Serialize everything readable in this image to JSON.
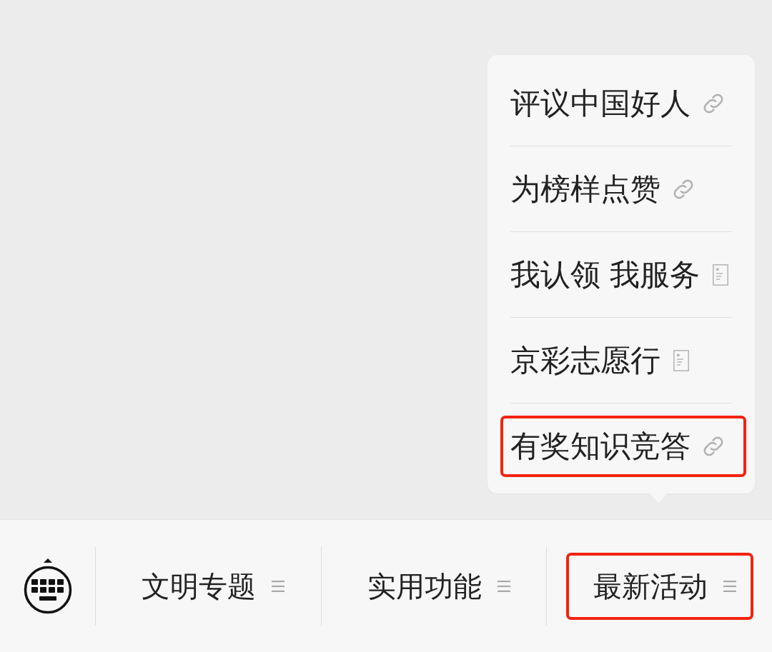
{
  "popup_menu": {
    "items": [
      {
        "label": "评议中国好人",
        "kind": "link",
        "highlighted": false
      },
      {
        "label": "为榜样点赞",
        "kind": "link",
        "highlighted": false
      },
      {
        "label": "我认领 我服务",
        "kind": "page",
        "highlighted": false
      },
      {
        "label": "京彩志愿行",
        "kind": "page",
        "highlighted": false
      },
      {
        "label": "有奖知识竞答",
        "kind": "link",
        "highlighted": true
      }
    ]
  },
  "bottom_bar": {
    "tabs": [
      {
        "label": "文明专题",
        "highlighted": false
      },
      {
        "label": "实用功能",
        "highlighted": false
      },
      {
        "label": "最新活动",
        "highlighted": true
      }
    ]
  }
}
